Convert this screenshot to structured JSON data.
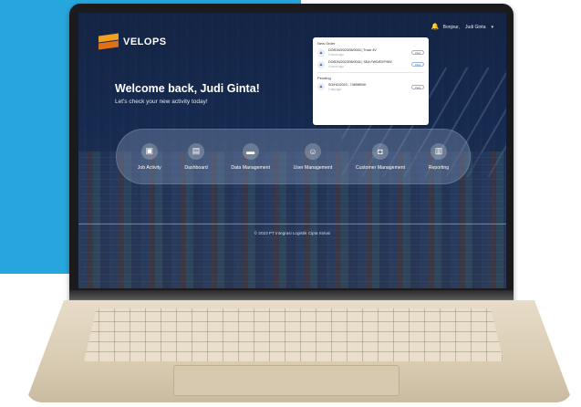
{
  "brand": {
    "name": "VELOPS"
  },
  "header": {
    "greeting_label": "Bonjour,",
    "user_name": "Judi Ginta",
    "user_chevron": "▾"
  },
  "hero": {
    "title": "Welcome back, Judi Ginta!",
    "subtitle": "Let's check your new activity today!"
  },
  "notifications": {
    "sections": [
      {
        "title": "New Order",
        "items": [
          {
            "title": "DO/IDN/2023/06/0015 | Truck 4V",
            "sub": "2 hours ago",
            "action": "View"
          },
          {
            "title": "DO/IDN/2023/06/0016 | SEA FWD/EXP/INV",
            "sub": "4 hours ago",
            "action": "View"
          }
        ]
      },
      {
        "title": "Pending",
        "items": [
          {
            "title": "SO/HO/2023 - 7489HBVK",
            "sub": "1 day ago",
            "action": "View"
          }
        ]
      }
    ]
  },
  "menu": {
    "items": [
      {
        "label": "Job Activity",
        "icon": "job-activity-icon",
        "glyph": "▣"
      },
      {
        "label": "Dashboard",
        "icon": "dashboard-icon",
        "glyph": "▤"
      },
      {
        "label": "Data Management",
        "icon": "data-management-icon",
        "glyph": "▬"
      },
      {
        "label": "User Management",
        "icon": "user-management-icon",
        "glyph": "☺"
      },
      {
        "label": "Customer Management",
        "icon": "customer-management-icon",
        "glyph": "◘"
      },
      {
        "label": "Reporting",
        "icon": "reporting-icon",
        "glyph": "▥"
      }
    ]
  },
  "footer": {
    "text": "© 2023 PT Integrasi Logistik Cipta Solusi"
  },
  "colors": {
    "background_blue": "#27a6dd",
    "brand_orange": "#f0a020",
    "brand_dark_orange": "#e07018",
    "screen_navy": "#14284e"
  }
}
